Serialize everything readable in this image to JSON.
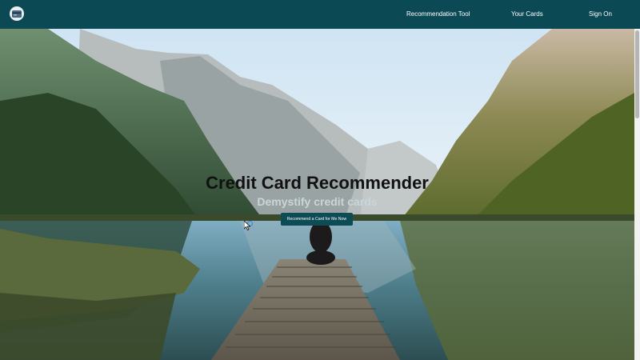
{
  "nav": {
    "logo_icon": "credit-card-icon",
    "links": [
      {
        "label": "Recommendation Tool"
      },
      {
        "label": "Your Cards"
      },
      {
        "label": "Sign On"
      }
    ]
  },
  "hero": {
    "title": "Credit Card Recommender",
    "subtitle": "Demystify credit cards",
    "cta_label": "Recommend a Card for Me Now",
    "background": "mountain-lake-pier-photo"
  },
  "colors": {
    "navbar": "#0b4a54",
    "button": "#0d4b55",
    "title": "#111111",
    "subtitle": "#c8d6d9"
  }
}
